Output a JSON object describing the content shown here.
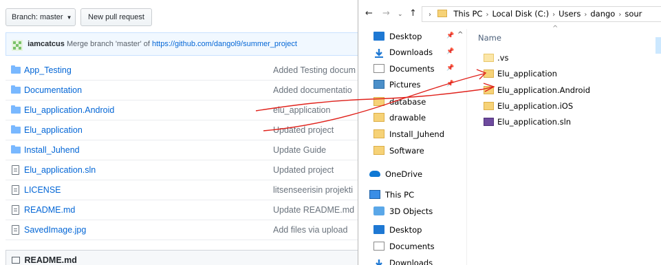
{
  "github": {
    "branch_label": "Branch: master",
    "new_pr_label": "New pull request",
    "commit": {
      "author": "iamcatcus",
      "message": "Merge branch 'master' of",
      "link": "https://github.com/dangol9/summer_project"
    },
    "files": [
      {
        "name": "App_Testing",
        "type": "folder",
        "message": "Added Testing docum"
      },
      {
        "name": "Documentation",
        "type": "folder",
        "message": "Added documentatio"
      },
      {
        "name": "Elu_application.Android",
        "type": "folder",
        "message": "elu_application"
      },
      {
        "name": "Elu_application",
        "type": "folder",
        "message": "Updated project"
      },
      {
        "name": "Install_Juhend",
        "type": "folder",
        "message": "Update Guide"
      },
      {
        "name": "Elu_application.sln",
        "type": "file",
        "message": "Updated project"
      },
      {
        "name": "LICENSE",
        "type": "file",
        "message": "litsenseerisin projekti"
      },
      {
        "name": "README.md",
        "type": "file",
        "message": "Update README.md"
      },
      {
        "name": "SavedImage.jpg",
        "type": "file",
        "message": "Add files via upload"
      }
    ],
    "readme_label": "README.md"
  },
  "explorer": {
    "breadcrumb": [
      "This PC",
      "Local Disk (C:)",
      "Users",
      "dango",
      "sour"
    ],
    "nav_back": "←",
    "nav_forward": "→",
    "nav_recent": "⌄",
    "nav_up": "↑",
    "column_name": "Name",
    "sort_caret": "^",
    "nav_caret": "^",
    "pin_glyph": "📌",
    "nav_items": [
      {
        "label": "Desktop",
        "icon": "desktop-icon",
        "pinned": true
      },
      {
        "label": "Downloads",
        "icon": "download-icon",
        "pinned": true
      },
      {
        "label": "Documents",
        "icon": "document-icon",
        "pinned": true
      },
      {
        "label": "Pictures",
        "icon": "pictures-icon",
        "pinned": true
      },
      {
        "label": "database",
        "icon": "folder-icon",
        "pinned": false
      },
      {
        "label": "drawable",
        "icon": "folder-icon",
        "pinned": false
      },
      {
        "label": "Install_Juhend",
        "icon": "folder-icon",
        "pinned": false
      },
      {
        "label": "Software",
        "icon": "folder-icon",
        "pinned": false
      },
      {
        "label": "OneDrive",
        "icon": "onedrive-icon",
        "pinned": false
      },
      {
        "label": "This PC",
        "icon": "pc-icon",
        "pinned": false
      },
      {
        "label": "3D Objects",
        "icon": "3d-objects-icon",
        "pinned": false
      },
      {
        "label": "Desktop",
        "icon": "desktop-icon",
        "pinned": false
      },
      {
        "label": "Documents",
        "icon": "document-icon",
        "pinned": false
      },
      {
        "label": "Downloads",
        "icon": "download-icon",
        "pinned": false
      }
    ],
    "items": [
      {
        "name": ".vs",
        "icon": "folder-icon"
      },
      {
        "name": "Elu_application",
        "icon": "folder-icon"
      },
      {
        "name": "Elu_application.Android",
        "icon": "folder-icon"
      },
      {
        "name": "Elu_application.iOS",
        "icon": "folder-icon"
      },
      {
        "name": "Elu_application.sln",
        "icon": "visual-studio-solution-icon"
      }
    ]
  },
  "colors": {
    "link": "#0366d6",
    "annotation": "#e0211b",
    "folder_blue": "#79b8ff",
    "folder_yellow": "#f6d277"
  }
}
